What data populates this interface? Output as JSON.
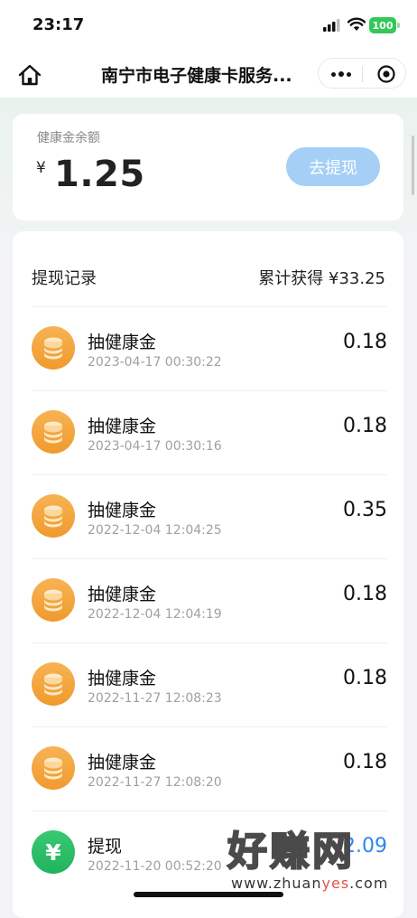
{
  "status_bar": {
    "time": "23:17",
    "battery": "100"
  },
  "nav": {
    "title": "南宁市电子健康卡服务..."
  },
  "balance": {
    "label": "健康金余额",
    "currency": "¥",
    "value": "1.25",
    "withdraw_label": "去提现"
  },
  "records": {
    "title": "提现记录",
    "total": "累计获得 ¥33.25",
    "items": [
      {
        "icon": "coin-stack-icon",
        "title": "抽健康金",
        "time": "2023-04-17  00:30:22",
        "amount": "0.18"
      },
      {
        "icon": "coin-stack-icon",
        "title": "抽健康金",
        "time": "2023-04-17  00:30:16",
        "amount": "0.18"
      },
      {
        "icon": "coin-stack-icon",
        "title": "抽健康金",
        "time": "2022-12-04  12:04:25",
        "amount": "0.35"
      },
      {
        "icon": "coin-stack-icon",
        "title": "抽健康金",
        "time": "2022-12-04  12:04:19",
        "amount": "0.18"
      },
      {
        "icon": "coin-stack-icon",
        "title": "抽健康金",
        "time": "2022-11-27  12:08:23",
        "amount": "0.18"
      },
      {
        "icon": "coin-stack-icon",
        "title": "抽健康金",
        "time": "2022-11-27  12:08:20",
        "amount": "0.18"
      },
      {
        "icon": "yuan-icon",
        "glyph": "¥",
        "title": "提现",
        "time": "2022-11-20  00:52:20",
        "amount": "-2.09"
      }
    ]
  },
  "watermark": {
    "main": "好赚网",
    "sub_a": "www.zhuan",
    "sub_b": "yes",
    "sub_c": ".com"
  },
  "colors": {
    "accent_blue": "#a5cff5",
    "coin_orange": "#f09a2d",
    "cash_green": "#22b35e",
    "negative_amount": "#2f86ea"
  }
}
